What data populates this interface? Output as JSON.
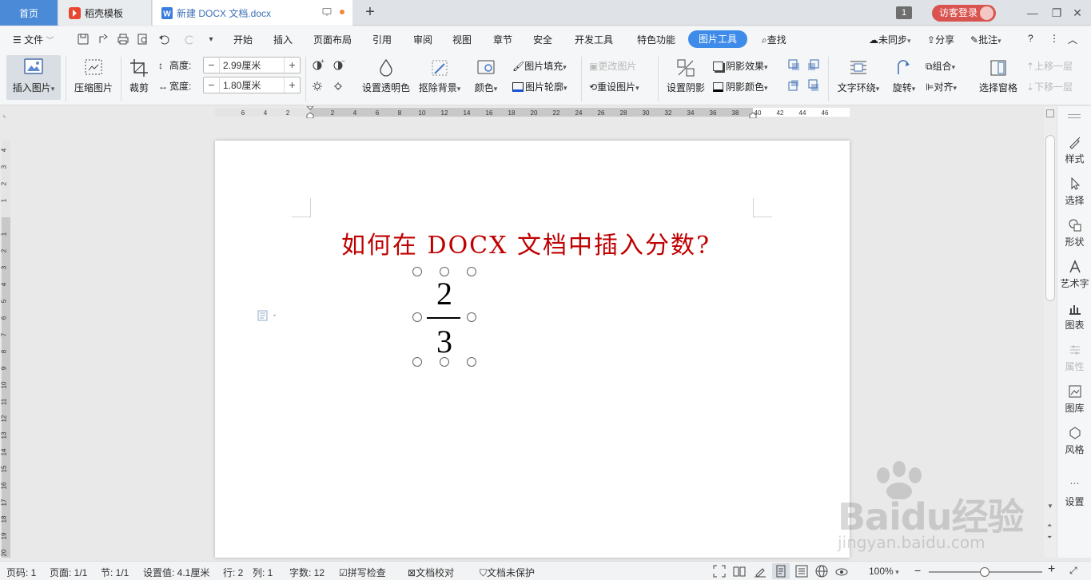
{
  "tabs": {
    "home": "首页",
    "template": "稻壳模板",
    "document": "新建 DOCX 文档.docx",
    "window_count": "1",
    "login": "访客登录"
  },
  "menu": {
    "file": "文件",
    "items": [
      "开始",
      "插入",
      "页面布局",
      "引用",
      "审阅",
      "视图",
      "章节",
      "安全",
      "开发工具",
      "特色功能"
    ],
    "active_tab": "图片工具",
    "search": "查找",
    "sync": "未同步",
    "share": "分享",
    "comment": "批注"
  },
  "ribbon": {
    "insert_picture": "插入图片",
    "compress_picture": "压缩图片",
    "crop": "裁剪",
    "height_label": "高度:",
    "height_value": "2.99厘米",
    "width_label": "宽度:",
    "width_value": "1.80厘米",
    "set_transparent": "设置透明色",
    "remove_background": "抠除背景",
    "color": "颜色",
    "picture_fill": "图片填充",
    "picture_outline": "图片轮廓",
    "change_picture": "更改图片",
    "reset_picture": "重设图片",
    "set_shadow": "设置阴影",
    "shadow_effect": "阴影效果",
    "shadow_color": "阴影颜色",
    "text_wrap": "文字环绕",
    "rotate": "旋转",
    "group": "组合",
    "align": "对齐",
    "selection_pane": "选择窗格",
    "bring_forward": "上移一层",
    "send_backward": "下移一层"
  },
  "ruler": {
    "h_labels_left": [
      "6",
      "4",
      "2"
    ],
    "h_labels_right": [
      "2",
      "4",
      "6",
      "8",
      "10",
      "12",
      "14",
      "16",
      "18",
      "20",
      "22",
      "24",
      "26",
      "28",
      "30",
      "32",
      "34",
      "36",
      "38",
      "40",
      "42",
      "44",
      "46"
    ],
    "v_labels_top": [
      "4",
      "3",
      "2",
      "1"
    ],
    "v_labels_bottom": [
      "1",
      "2",
      "3",
      "4",
      "5",
      "6",
      "7",
      "8",
      "9",
      "10",
      "11",
      "12",
      "13",
      "14",
      "15",
      "16",
      "17",
      "18",
      "19",
      "20"
    ]
  },
  "document": {
    "title": "如何在 DOCX 文档中插入分数?",
    "numerator": "2",
    "denominator": "3",
    "title_color": "#c00000"
  },
  "right_panel": {
    "style": "样式",
    "select": "选择",
    "shape": "形状",
    "wordart": "艺术字",
    "chart": "图表",
    "properties": "属性",
    "library": "图库",
    "theme": "风格",
    "settings": "设置"
  },
  "status": {
    "page_num": "页码: 1",
    "page": "页面: 1/1",
    "section": "节: 1/1",
    "setting": "设置值: 4.1厘米",
    "row": "行: 2",
    "col": "列: 1",
    "words": "字数: 12",
    "spell": "拼写检查",
    "proof": "文档校对",
    "protect": "文档未保护",
    "zoom": "100%"
  },
  "watermark": {
    "brand": "Baidu经验",
    "url": "jingyan.baidu.com"
  },
  "colors": {
    "accent": "#3f8bea",
    "home_tab": "#4a8ad6",
    "login": "#d9534f"
  }
}
